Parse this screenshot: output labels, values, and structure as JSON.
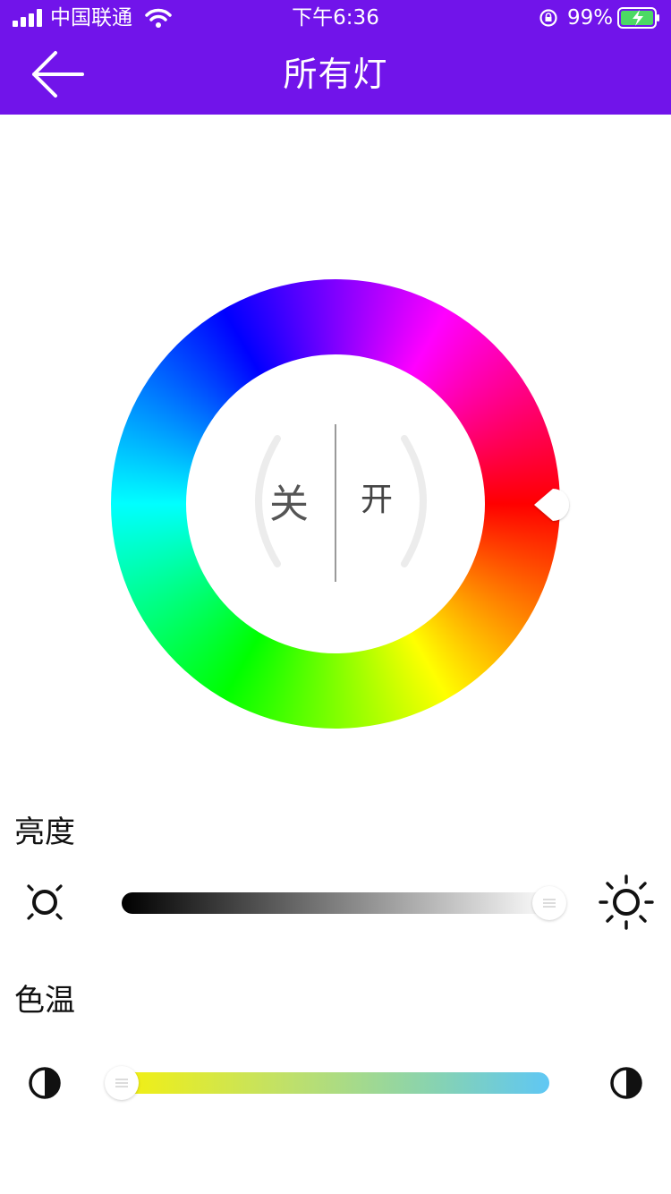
{
  "status_bar": {
    "carrier": "中国联通",
    "time": "下午6:36",
    "battery_percent": "99%"
  },
  "nav": {
    "title": "所有灯",
    "back_icon": "arrow-left-icon"
  },
  "color_wheel": {
    "off_label": "关",
    "on_label": "开",
    "selected_hue_deg": 0
  },
  "brightness": {
    "label": "亮度",
    "value_fraction": 1.0,
    "min_icon": "sun-dim-icon",
    "max_icon": "sun-bright-icon"
  },
  "color_temperature": {
    "label": "色温",
    "value_fraction": 0.0,
    "min_icon": "half-circle-left-icon",
    "max_icon": "half-circle-right-icon",
    "track_colors": [
      "#f6f10d",
      "#5fc7f4"
    ]
  },
  "colors": {
    "nav_background": "#7114ea",
    "page_background": "#ffffff"
  }
}
